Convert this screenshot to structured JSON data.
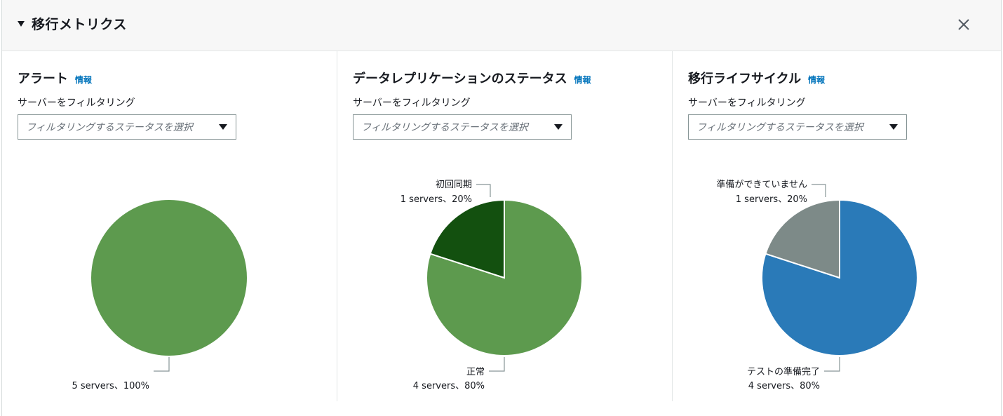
{
  "header": {
    "title": "移行メトリクス"
  },
  "info_label": "情報",
  "filter_label": "サーバーをフィルタリング",
  "filter_placeholder": "フィルタリングするステータスを選択",
  "panels": [
    {
      "title": "アラート"
    },
    {
      "title": "データレプリケーションのステータス"
    },
    {
      "title": "移行ライフサイクル"
    }
  ],
  "chart_data": [
    {
      "type": "pie",
      "title": "アラート",
      "slices": [
        {
          "name": "",
          "value": 5,
          "percent": 100,
          "label": "5 servers、100%",
          "color": "#5d9a4e"
        }
      ]
    },
    {
      "type": "pie",
      "title": "データレプリケーションのステータス",
      "slices": [
        {
          "name": "初回同期",
          "value": 1,
          "percent": 20,
          "label": "1 servers、20%",
          "color": "#13500f"
        },
        {
          "name": "正常",
          "value": 4,
          "percent": 80,
          "label": "4 servers、80%",
          "color": "#5d9a4e"
        }
      ]
    },
    {
      "type": "pie",
      "title": "移行ライフサイクル",
      "slices": [
        {
          "name": "準備ができていません",
          "value": 1,
          "percent": 20,
          "label": "1 servers、20%",
          "color": "#7d8a88"
        },
        {
          "name": "テストの準備完了",
          "value": 4,
          "percent": 80,
          "label": "4 servers、80%",
          "color": "#2a7ab8"
        }
      ]
    }
  ]
}
